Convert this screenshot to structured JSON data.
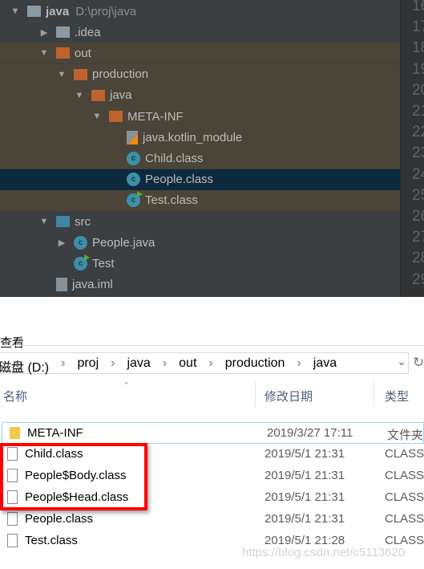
{
  "ide": {
    "tree": [
      {
        "label": "java",
        "path": "D:\\proj\\java",
        "icon": "module-folder-icon",
        "expanded": true
      },
      {
        "label": ".idea",
        "icon": "folder-icon",
        "expanded": false
      },
      {
        "label": "out",
        "icon": "excluded-folder-icon",
        "expanded": true
      },
      {
        "label": "production",
        "icon": "excluded-folder-icon",
        "expanded": true
      },
      {
        "label": "java",
        "icon": "excluded-folder-icon",
        "expanded": true
      },
      {
        "label": "META-INF",
        "icon": "excluded-folder-icon",
        "expanded": true
      },
      {
        "label": "java.kotlin_module",
        "icon": "kotlin-file-icon"
      },
      {
        "label": "Child.class",
        "icon": "class-icon"
      },
      {
        "label": "People.class",
        "icon": "class-icon",
        "selected": true
      },
      {
        "label": "Test.class",
        "icon": "runnable-class-icon"
      },
      {
        "label": "src",
        "icon": "source-folder-icon",
        "expanded": true
      },
      {
        "label": "People.java",
        "icon": "class-icon",
        "expanded": false
      },
      {
        "label": "Test",
        "icon": "runnable-class-icon"
      },
      {
        "label": "java.iml",
        "icon": "iml-file-icon"
      }
    ],
    "line_numbers": [
      "16",
      "17",
      "18",
      "19",
      "20",
      "21",
      "22",
      "23",
      "24",
      "25",
      "26",
      "27",
      "28",
      "29"
    ],
    "colors": {
      "bg": "#3c3f41",
      "excluded_bg": "#4a4538",
      "selected_bg": "#0d293e",
      "excluded_folder": "#c0622d",
      "class_icon": "#3d8fa8"
    }
  },
  "explorer": {
    "menu_view": "查看",
    "breadcrumb": [
      "磁盘 (D:)",
      "proj",
      "java",
      "out",
      "production",
      "java"
    ],
    "columns": {
      "name": "名称",
      "date": "修改日期",
      "type": "类型"
    },
    "files": [
      {
        "name": "META-INF",
        "date": "2019/3/27 17:11",
        "type": "文件夹",
        "icon": "folder-icon"
      },
      {
        "name": "Child.class",
        "date": "2019/5/1 21:31",
        "type": "CLASS",
        "icon": "file-icon"
      },
      {
        "name": "People$Body.class",
        "date": "2019/5/1 21:31",
        "type": "CLASS",
        "icon": "file-icon"
      },
      {
        "name": "People$Head.class",
        "date": "2019/5/1 21:31",
        "type": "CLASS",
        "icon": "file-icon"
      },
      {
        "name": "People.class",
        "date": "2019/5/1 21:31",
        "type": "CLASS",
        "icon": "file-icon"
      },
      {
        "name": "Test.class",
        "date": "2019/5/1 21:28",
        "type": "CLASS",
        "icon": "file-icon"
      }
    ],
    "watermark": "https://blog.csdn.net/c5113620",
    "highlight_color": "#ff0000"
  }
}
